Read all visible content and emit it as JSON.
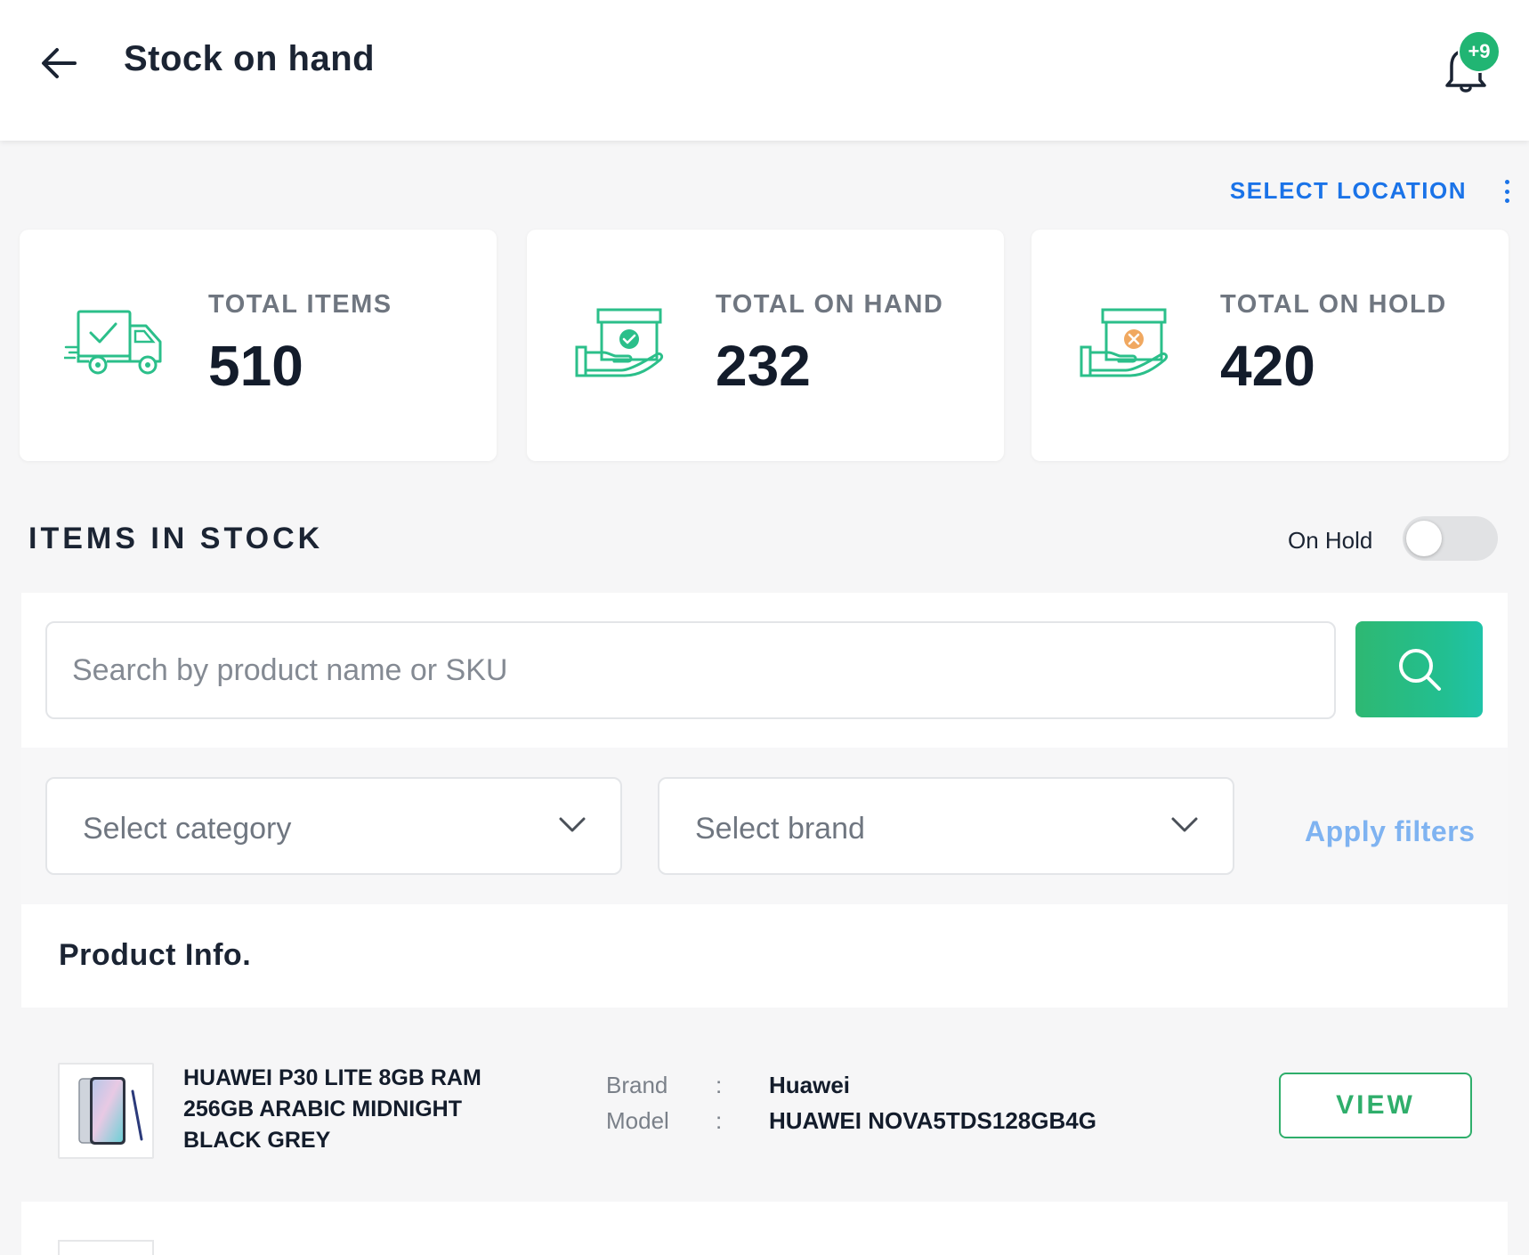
{
  "header": {
    "title": "Stock on hand",
    "notification_badge": "+9"
  },
  "location": {
    "select_label": "SELECT LOCATION"
  },
  "stats": [
    {
      "label": "TOTAL ITEMS",
      "value": "510",
      "icon": "delivery-truck-icon"
    },
    {
      "label": "TOTAL ON HAND",
      "value": "232",
      "icon": "box-in-hand-check-icon"
    },
    {
      "label": "TOTAL ON HOLD",
      "value": "420",
      "icon": "box-in-hand-cross-icon"
    }
  ],
  "items_section": {
    "title": "ITEMS IN STOCK",
    "on_hold_label": "On Hold",
    "on_hold_enabled": false
  },
  "search": {
    "placeholder": "Search by product name or SKU"
  },
  "filters": {
    "category_placeholder": "Select category",
    "brand_placeholder": "Select brand",
    "apply_label": "Apply filters"
  },
  "products": {
    "header": "Product Info.",
    "items": [
      {
        "name": "HUAWEI P30 LITE 8GB RAM 256GB ARABIC MIDNIGHT BLACK GREY",
        "brand_label": "Brand",
        "brand": "Huawei",
        "model_label": "Model",
        "model": "HUAWEI NOVA5TDS128GB4G",
        "separator": ":",
        "view_label": "VIEW"
      }
    ]
  },
  "colors": {
    "accent_green": "#2fae6b",
    "link_blue": "#1a73e8",
    "apply_blue": "#7fb3f1",
    "badge_green": "#21b573",
    "icon_green": "#2bbf8a",
    "hold_orange": "#f0a860"
  }
}
